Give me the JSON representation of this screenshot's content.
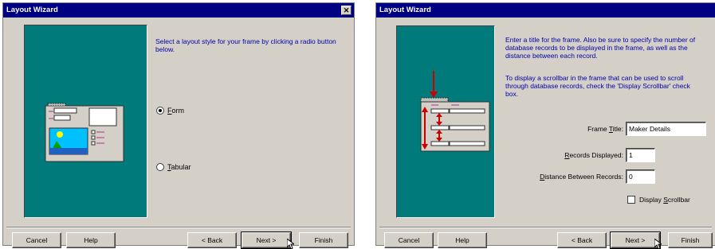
{
  "window1": {
    "title": "Layout Wizard",
    "close_glyph": "✕",
    "instruction": "Select a layout style for your frame by clicking a radio button below.",
    "options": [
      {
        "label_accel": "F",
        "label_rest": "orm",
        "selected": true
      },
      {
        "label_accel": "T",
        "label_rest": "abular",
        "selected": false
      }
    ],
    "buttons": {
      "cancel": "Cancel",
      "help": "Help",
      "back": "< Back",
      "next": "Next >",
      "finish": "Finish"
    }
  },
  "window2": {
    "title": "Layout Wizard",
    "instruction1": "Enter a title for the frame. Also be sure to specify the number of database records to be displayed in the frame, as well as the distance between each record.",
    "instruction2": "To display a scrollbar in the frame that can be used to scroll through database records, check the 'Display Scrollbar' check box.",
    "fields": {
      "frame_title": {
        "label_pre": "Frame ",
        "label_accel": "T",
        "label_post": "itle:",
        "value": "Maker Details"
      },
      "records_displayed": {
        "label_pre": "",
        "label_accel": "R",
        "label_post": "ecords Displayed:",
        "value": "1"
      },
      "distance": {
        "label_pre": "",
        "label_accel": "D",
        "label_post": "istance Between Records:",
        "value": "0"
      }
    },
    "checkbox": {
      "label_pre": "Display ",
      "label_accel": "S",
      "label_post": "crollbar",
      "checked": false
    },
    "buttons": {
      "cancel": "Cancel",
      "help": "Help",
      "back": "< Back",
      "next": "Next >",
      "finish": "Finish"
    }
  },
  "colors": {
    "titlebar": "#000082",
    "preview": "#007a7a",
    "instruction_text": "#0000a8",
    "arrow": "#cc0000"
  },
  "icons": [
    "close-icon",
    "mouse-pointer-icon"
  ]
}
